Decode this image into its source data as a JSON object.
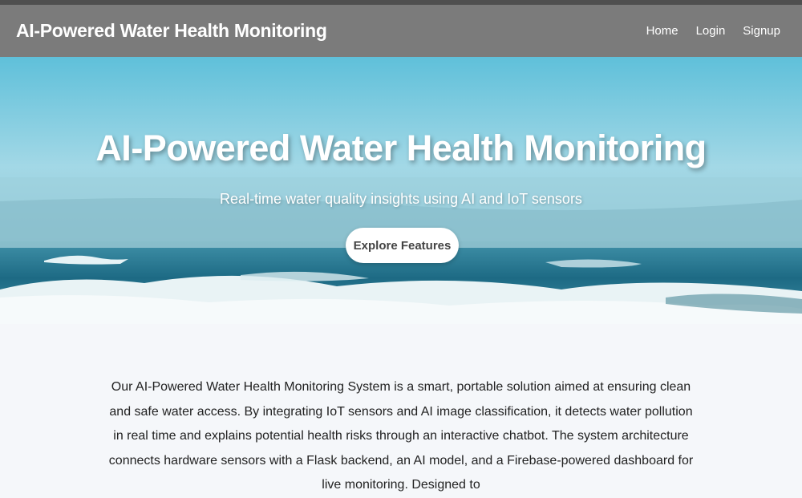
{
  "navbar": {
    "brand": "AI-Powered Water Health Monitoring",
    "links": [
      "Home",
      "Login",
      "Signup"
    ]
  },
  "hero": {
    "title": "AI-Powered Water Health Monitoring",
    "subtitle": "Real-time water quality insights using AI and IoT sensors",
    "cta_label": "Explore Features"
  },
  "about": {
    "text": "Our AI-Powered Water Health Monitoring System is a smart, portable solution aimed at ensuring clean and safe water access. By integrating IoT sensors and AI image classification, it detects water pollution in real time and explains potential health risks through an interactive chatbot. The system architecture connects hardware sensors with a Flask backend, an AI model, and a Firebase-powered dashboard for live monitoring. Designed to"
  },
  "colors": {
    "navbar_bg": "#7b7b7b",
    "page_bg": "#f5f7fa",
    "cta_bg": "#ffffff",
    "cta_text": "#444444"
  }
}
